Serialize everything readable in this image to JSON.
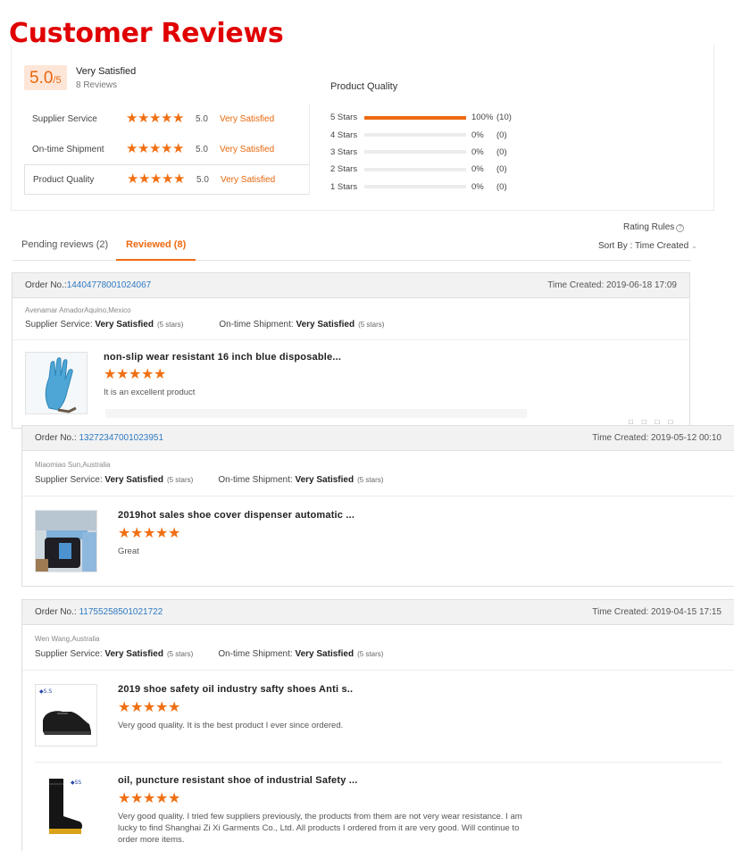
{
  "page_title": "Customer Reviews",
  "summary": {
    "score": "5.0",
    "score_of": "/5",
    "satisfaction": "Very Satisfied",
    "review_count": "8 Reviews",
    "dimensions": [
      {
        "name": "Supplier Service",
        "stars": 5,
        "value": "5.0",
        "level": "Very Satisfied"
      },
      {
        "name": "On-time Shipment",
        "stars": 5,
        "value": "5.0",
        "level": "Very Satisfied"
      },
      {
        "name": "Product Quality",
        "stars": 5,
        "value": "5.0",
        "level": "Very Satisfied"
      }
    ],
    "product_quality_title": "Product Quality",
    "distribution": [
      {
        "label": "5 Stars",
        "pct": "100%",
        "count": "(10)",
        "fill": 1.0
      },
      {
        "label": "4 Stars",
        "pct": "0%",
        "count": "(0)",
        "fill": 0
      },
      {
        "label": "3 Stars",
        "pct": "0%",
        "count": "(0)",
        "fill": 0
      },
      {
        "label": "2 Stars",
        "pct": "0%",
        "count": "(0)",
        "fill": 0
      },
      {
        "label": "1 Stars",
        "pct": "0%",
        "count": "(0)",
        "fill": 0
      }
    ]
  },
  "rating_rules": "Rating Rules",
  "tabs": {
    "pending": "Pending reviews (2)",
    "reviewed": "Reviewed (8)"
  },
  "sort_by": "Sort By : Time Created",
  "labels": {
    "order_no": "Order No.:",
    "time_created": "Time Created:",
    "supplier_service": "Supplier Service:",
    "ontime_shipment": "On-time Shipment:",
    "very_satisfied": "Very Satisfied",
    "five_stars": "(5 stars)"
  },
  "reviews": [
    {
      "order_no": "14404778001024067",
      "time": "2019-06-18 17:09",
      "buyer": "Avenamar AmadorAquino,Mexico",
      "products": [
        {
          "name": "non-slip wear resistant 16 inch blue disposable...",
          "stars": 5,
          "comment": "It is an excellent product"
        }
      ]
    },
    {
      "order_no": "13272347001023951",
      "time": "2019-05-12 00:10",
      "buyer": "Miaomiao Sun,Australia",
      "products": [
        {
          "name": "2019hot sales shoe cover dispenser automatic ...",
          "stars": 5,
          "comment": "Great"
        }
      ]
    },
    {
      "order_no": "11755258501021722",
      "time": "2019-04-15 17:15",
      "buyer": "Wen Wang,Australia",
      "products": [
        {
          "name": "2019 shoe safety oil industry safty shoes Anti s..",
          "stars": 5,
          "comment": "Very good quality. It is the best product I ever since ordered."
        },
        {
          "name": "oil, puncture resistant shoe of industrial Safety ...",
          "stars": 5,
          "comment": "Very good quality. I tried few suppliers previously, the products from them are not very wear resistance. I am lucky to find Shanghai Zi Xi Garments Co., Ltd. All products I ordered from it are very good. Will continue to order more items."
        }
      ]
    }
  ],
  "icons": {
    "star": "star-icon",
    "help": "question-circle-icon",
    "sort": "chevron-down-icon"
  },
  "colors": {
    "title": "#e00000",
    "accent": "#ef6a12",
    "link": "#2f7ac2"
  }
}
